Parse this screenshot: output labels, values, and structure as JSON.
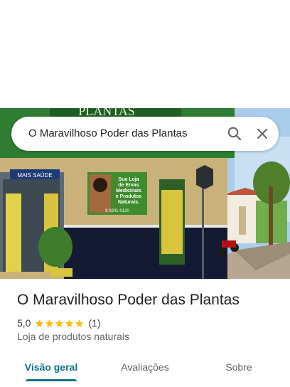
{
  "search": {
    "query": "O Maravilhoso Poder das Plantas"
  },
  "photo": {
    "storefront_sign_top": "PLANTAS",
    "banner_line1": "Sua Loja",
    "banner_line2": "de Ervas",
    "banner_line3": "Medicinais",
    "banner_line4": "e Produtos",
    "banner_line5": "Naturais.",
    "banner_phone": "9 0201-0120",
    "door_sign": "MAIS SAÚDE"
  },
  "place": {
    "title": "O Maravilhoso Poder das Plantas",
    "rating": "5,0",
    "stars": 5,
    "review_count": "(1)",
    "category": "Loja de produtos naturais"
  },
  "tabs": [
    {
      "label": "Visão geral",
      "active": true
    },
    {
      "label": "Avaliações",
      "active": false
    },
    {
      "label": "Sobre",
      "active": false
    }
  ],
  "colors": {
    "accent": "#0b7285",
    "star": "#fbbc04",
    "storefront_green": "#2e7d32"
  }
}
